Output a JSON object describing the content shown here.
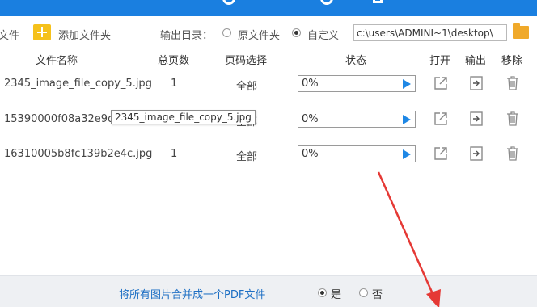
{
  "colors": {
    "accent": "#1a7fe0",
    "link": "#1d6fc4",
    "arrow": "#e53935",
    "folder": "#f0a92a",
    "add_icon": "#f5c11b"
  },
  "toolbar": {
    "file_menu": "文件",
    "add_folder_label": "添加文件夹",
    "output_dir_label": "输出目录：",
    "option_original": "原文件夹",
    "option_custom": "自定义",
    "selected_option": "自定义",
    "output_path": "c:\\users\\ADMINI~1\\desktop\\",
    "icons": {
      "add_folder": "plus-folder-icon",
      "browse": "folder-icon"
    }
  },
  "table": {
    "headers": {
      "name": "文件名称",
      "pages": "总页数",
      "page_range": "页码选择",
      "status": "状态",
      "open": "打开",
      "output": "输出",
      "remove": "移除"
    },
    "rows": [
      {
        "name": "2345_image_file_copy_5.jpg",
        "pages": "1",
        "page_range": "全部",
        "progress": "0%",
        "progress_value": 0
      },
      {
        "name": "15390000f08a32e9df",
        "pages": "1",
        "page_range": "全部",
        "progress": "0%",
        "progress_value": 0
      },
      {
        "name": "16310005b8fc139b2e4c.jpg",
        "pages": "1",
        "page_range": "全部",
        "progress": "0%",
        "progress_value": 0
      }
    ],
    "row_icons": {
      "start": "play-icon",
      "open": "external-link-icon",
      "output": "output-icon",
      "remove": "trash-icon"
    }
  },
  "tooltip": {
    "text": "2345_image_file_copy_5.jpg"
  },
  "footer": {
    "merge_label": "将所有图片合并成一个PDF文件",
    "yes": "是",
    "no": "否",
    "selected": "是"
  }
}
